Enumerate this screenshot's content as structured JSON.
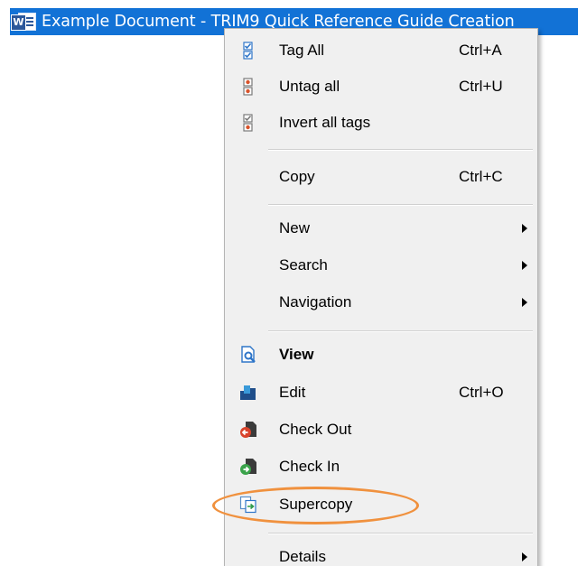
{
  "record": {
    "icon": "word-document-icon",
    "title": "Example Document - TRIM9 Quick Reference Guide Creation"
  },
  "menu": {
    "items": [
      {
        "label": "Tag All",
        "shortcut": "Ctrl+A",
        "icon": "tag-all-icon"
      },
      {
        "label": "Untag all",
        "shortcut": "Ctrl+U",
        "icon": "untag-all-icon"
      },
      {
        "label": "Invert all tags",
        "shortcut": "",
        "icon": "invert-tags-icon"
      },
      {
        "label": "Copy",
        "shortcut": "Ctrl+C",
        "icon": ""
      },
      {
        "label": "New",
        "shortcut": "",
        "icon": "",
        "submenu": true
      },
      {
        "label": "Search",
        "shortcut": "",
        "icon": "",
        "submenu": true
      },
      {
        "label": "Navigation",
        "shortcut": "",
        "icon": "",
        "submenu": true
      },
      {
        "label": "View",
        "shortcut": "",
        "icon": "view-icon",
        "bold": true
      },
      {
        "label": "Edit",
        "shortcut": "Ctrl+O",
        "icon": "edit-icon"
      },
      {
        "label": "Check Out",
        "shortcut": "",
        "icon": "check-out-icon"
      },
      {
        "label": "Check In",
        "shortcut": "",
        "icon": "check-in-icon"
      },
      {
        "label": "Supercopy",
        "shortcut": "",
        "icon": "supercopy-icon",
        "highlighted": true
      },
      {
        "label": "Details",
        "shortcut": "",
        "icon": "",
        "submenu": true
      }
    ]
  },
  "colors": {
    "selection": "#1272d6",
    "menu_background": "#f0f0f0",
    "annotation": "#f0913e"
  }
}
